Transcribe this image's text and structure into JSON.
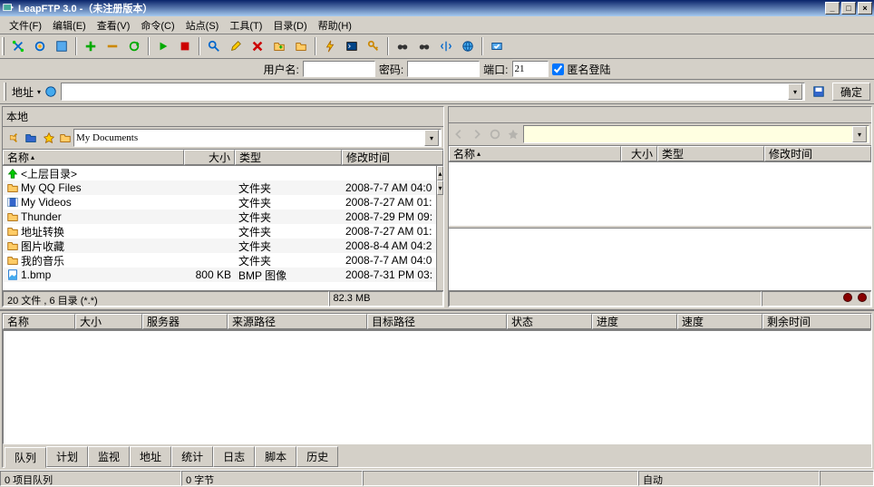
{
  "window": {
    "title": "LeapFTP 3.0 -（未注册版本）"
  },
  "menu": {
    "file": "文件(F)",
    "edit": "编辑(E)",
    "view": "查看(V)",
    "cmd": "命令(C)",
    "site": "站点(S)",
    "tools": "工具(T)",
    "dir": "目录(D)",
    "help": "帮助(H)"
  },
  "conn": {
    "user_lbl": "用户名:",
    "pass_lbl": "密码:",
    "port_lbl": "端口:",
    "port_val": "21",
    "anon_lbl": "匿名登陆"
  },
  "addr": {
    "lbl": "地址",
    "ok": "确定"
  },
  "local": {
    "title": "本地",
    "path": "My Documents",
    "cols": {
      "name": "名称",
      "size": "大小",
      "type": "类型",
      "mtime": "修改时间"
    },
    "up": "<上层目录>",
    "rows": [
      {
        "name": "My QQ Files",
        "size": "",
        "type": "文件夹",
        "mtime": "2008-7-7 AM 04:0"
      },
      {
        "name": "My Videos",
        "size": "",
        "type": "文件夹",
        "mtime": "2008-7-27 AM 01:"
      },
      {
        "name": "Thunder",
        "size": "",
        "type": "文件夹",
        "mtime": "2008-7-29 PM 09:"
      },
      {
        "name": "地址转换",
        "size": "",
        "type": "文件夹",
        "mtime": "2008-7-27 AM 01:"
      },
      {
        "name": "图片收藏",
        "size": "",
        "type": "文件夹",
        "mtime": "2008-8-4 AM 04:2"
      },
      {
        "name": "我的音乐",
        "size": "",
        "type": "文件夹",
        "mtime": "2008-7-7 AM 04:0"
      },
      {
        "name": "1.bmp",
        "size": "800 KB",
        "type": "BMP 图像",
        "mtime": "2008-7-31 PM 03:"
      }
    ],
    "status_count": "20 文件 , 6 目录 (*.*)",
    "status_size": "82.3 MB"
  },
  "remote": {
    "cols": {
      "name": "名称",
      "size": "大小",
      "type": "类型",
      "mtime": "修改时间"
    }
  },
  "queue": {
    "cols": {
      "name": "名称",
      "size": "大小",
      "server": "服务器",
      "src": "来源路径",
      "dst": "目标路径",
      "status": "状态",
      "progress": "进度",
      "speed": "速度",
      "remain": "剩余时间"
    },
    "tabs": {
      "queue": "队列",
      "plan": "计划",
      "monitor": "监视",
      "addr": "地址",
      "stats": "统计",
      "log": "日志",
      "script": "脚本",
      "history": "历史"
    }
  },
  "statusbar": {
    "items": "0 项目队列",
    "bytes": "0 字节",
    "auto": "自动"
  }
}
